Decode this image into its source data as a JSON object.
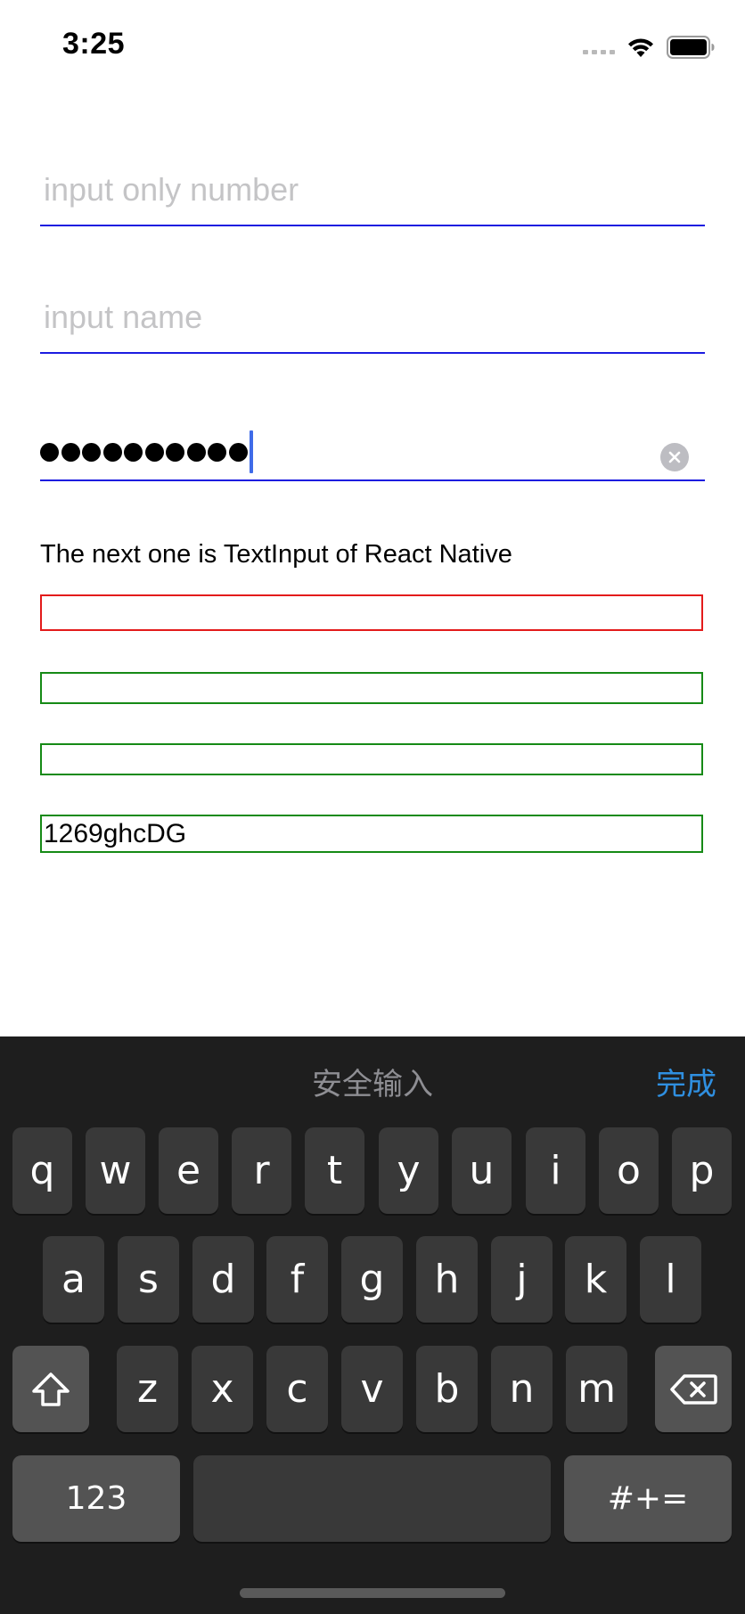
{
  "status_bar": {
    "time": "3:25"
  },
  "inputs": {
    "number_placeholder": "input only number",
    "name_placeholder": "input name",
    "password_length": 10
  },
  "rn_section": {
    "label": "The next one is TextInput of React Native",
    "last_input_value": "1269ghcDG"
  },
  "keyboard": {
    "title": "安全输入",
    "done_label": "完成",
    "row1": [
      "q",
      "w",
      "e",
      "r",
      "t",
      "y",
      "u",
      "i",
      "o",
      "p"
    ],
    "row2": [
      "a",
      "s",
      "d",
      "f",
      "g",
      "h",
      "j",
      "k",
      "l"
    ],
    "row3": [
      "z",
      "x",
      "c",
      "v",
      "b",
      "n",
      "m"
    ],
    "numbers_label": "123",
    "symbols_label": "#+="
  },
  "colors": {
    "underline": "#1c1ce0",
    "error_border": "#e31b1b",
    "ok_border": "#168a16",
    "caret": "#3f6be8",
    "done": "#2f8fe0"
  }
}
